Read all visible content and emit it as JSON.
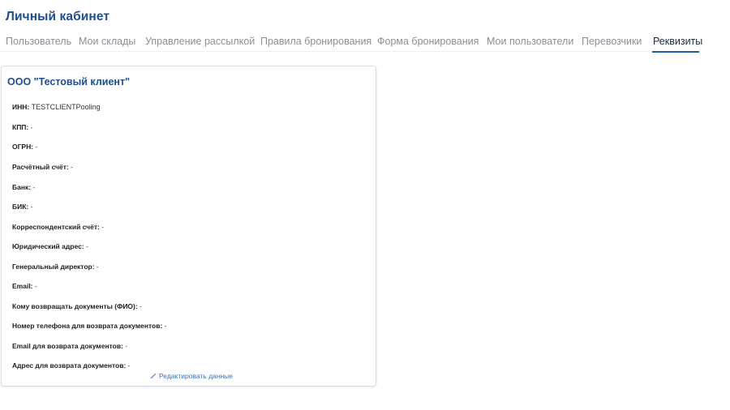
{
  "header": {
    "title": "Личный кабинет"
  },
  "tabs": [
    {
      "label": "Пользователь",
      "active": false
    },
    {
      "label": "Мои склады",
      "active": false
    },
    {
      "label": "Управление рассылкой",
      "active": false
    },
    {
      "label": "Правила бронирования",
      "active": false
    },
    {
      "label": "Форма бронирования",
      "active": false
    },
    {
      "label": "Мои пользователи",
      "active": false
    },
    {
      "label": "Перевозчики",
      "active": false
    },
    {
      "label": "Реквизиты",
      "active": true
    }
  ],
  "card": {
    "title": "ООО \"Тестовый клиент\"",
    "rows": [
      {
        "label": "ИНН:",
        "value": "TESTCLIENTPooling"
      },
      {
        "label": "КПП:",
        "value": " -"
      },
      {
        "label": "ОГРН:",
        "value": " -"
      },
      {
        "label": "Расчётный счёт:",
        "value": " -"
      },
      {
        "label": "Банк:",
        "value": " -"
      },
      {
        "label": "БИК:",
        "value": " -"
      },
      {
        "label": "Корреспондентский счёт:",
        "value": " -"
      },
      {
        "label": "Юридический адрес:",
        "value": " -"
      },
      {
        "label": "Генеральный директор:",
        "value": " -"
      },
      {
        "label": "Email:",
        "value": " -"
      },
      {
        "label": "Кому возвращать документы (ФИО):",
        "value": " -"
      },
      {
        "label": "Номер телефона для возврата документов:",
        "value": " -"
      },
      {
        "label": "Email для возврата документов:",
        "value": " -"
      },
      {
        "label": "Адрес для возврата документов:",
        "value": " -"
      }
    ],
    "edit_label": "Редактировать данные",
    "edit_icon": "pencil-icon"
  },
  "colors": {
    "accent": "#1f4e8c",
    "link": "#3b6fb0",
    "tab_inactive": "#8a8f96",
    "tab_active": "#1e2a38",
    "underline": "#1f5fa8"
  }
}
